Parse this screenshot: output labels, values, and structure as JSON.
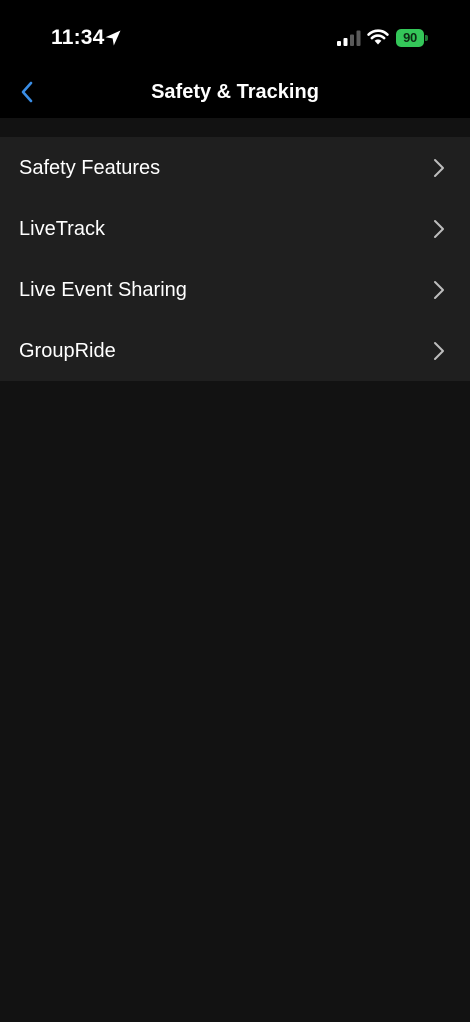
{
  "status_bar": {
    "time": "11:34",
    "battery_level": "90",
    "battery_color": "#34c759",
    "icons": [
      "location-arrow-icon",
      "cellular-signal-icon",
      "wifi-icon",
      "battery-icon"
    ]
  },
  "nav": {
    "title": "Safety & Tracking",
    "back_icon": "chevron-left-icon",
    "accent_color": "#3a8ee6"
  },
  "menu": {
    "items": [
      {
        "label": "Safety Features",
        "icon": "chevron-right-icon"
      },
      {
        "label": "LiveTrack",
        "icon": "chevron-right-icon"
      },
      {
        "label": "Live Event Sharing",
        "icon": "chevron-right-icon"
      },
      {
        "label": "GroupRide",
        "icon": "chevron-right-icon"
      }
    ]
  }
}
